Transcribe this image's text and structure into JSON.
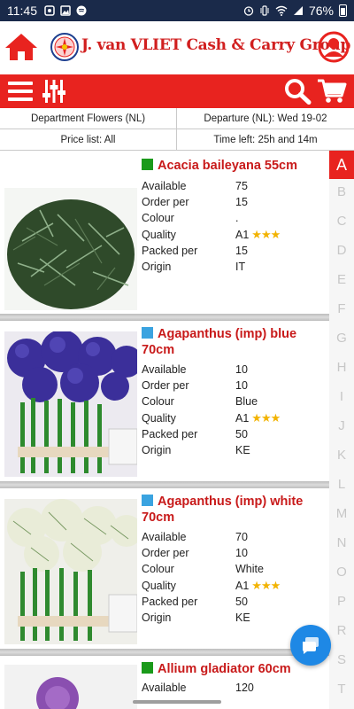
{
  "status_bar": {
    "time": "11:45",
    "battery": "76%"
  },
  "header": {
    "brand": "J. van VLIET Cash & Carry Group"
  },
  "info": {
    "department": "Department Flowers (NL)",
    "departure": "Departure (NL): Wed 19-02",
    "price_list": "Price list: All",
    "time_left": "Time left: 25h and 14m"
  },
  "labels": {
    "available": "Available",
    "order_per": "Order per",
    "colour": "Colour",
    "quality": "Quality",
    "packed_per": "Packed per",
    "origin": "Origin"
  },
  "products": [
    {
      "name": "Acacia baileyana 55cm",
      "marker_color": "#1a9a1a",
      "available": "75",
      "order_per": "15",
      "colour": ".",
      "quality": "A1",
      "stars": "★★★",
      "packed_per": "15",
      "origin": "IT"
    },
    {
      "name": "Agapanthus (imp) blue 70cm",
      "marker_color": "#3aa3e0",
      "available": "10",
      "order_per": "10",
      "colour": "Blue",
      "quality": "A1",
      "stars": "★★★",
      "packed_per": "50",
      "origin": "KE"
    },
    {
      "name": "Agapanthus (imp) white 70cm",
      "marker_color": "#3aa3e0",
      "available": "70",
      "order_per": "10",
      "colour": "White",
      "quality": "A1",
      "stars": "★★★",
      "packed_per": "50",
      "origin": "KE"
    },
    {
      "name": "Allium gladiator 60cm",
      "marker_color": "#1a9a1a",
      "available": "120"
    }
  ],
  "alphabet": [
    "A",
    "B",
    "C",
    "D",
    "E",
    "F",
    "G",
    "H",
    "I",
    "J",
    "K",
    "L",
    "M",
    "N",
    "O",
    "P",
    "R",
    "S",
    "T"
  ],
  "active_letter": "A",
  "colors": {
    "accent": "#e8231f",
    "brand_text": "#d11f1f",
    "title": "#c81a1a",
    "fab": "#1e88e5"
  }
}
